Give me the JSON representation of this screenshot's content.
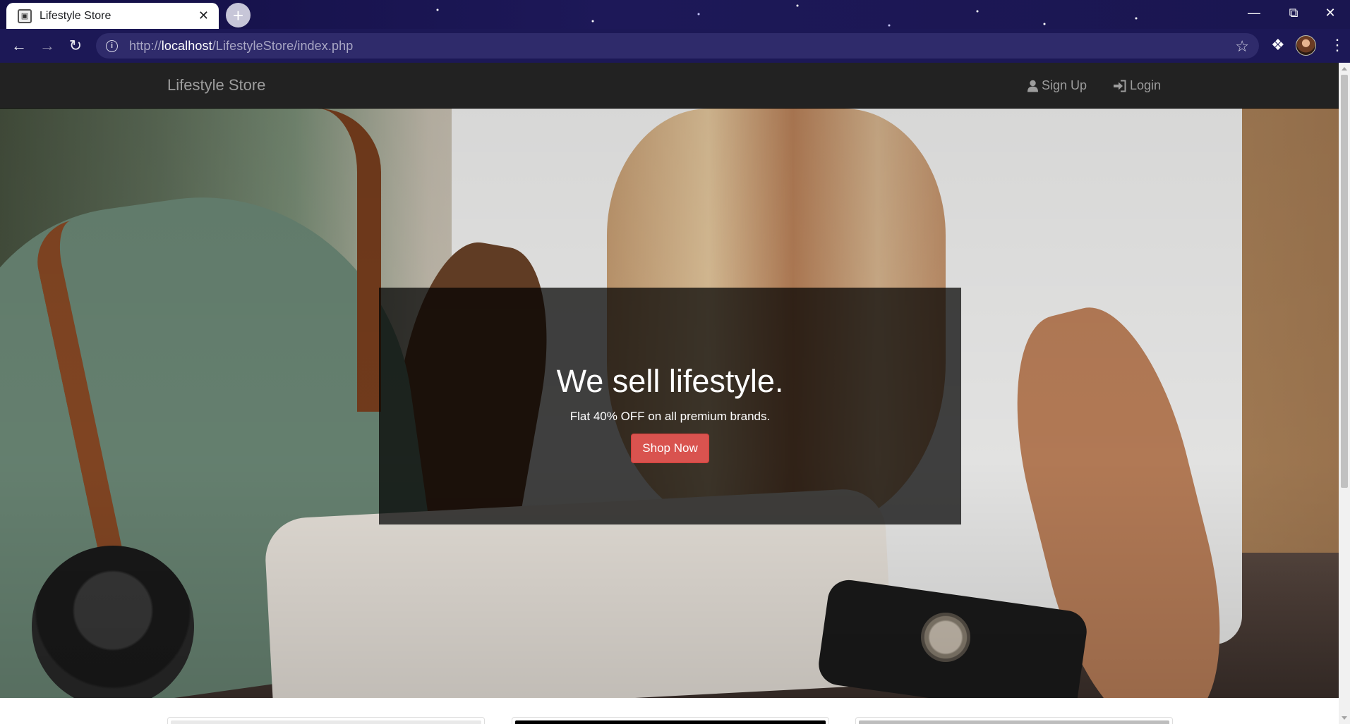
{
  "browser": {
    "tab_title": "Lifestyle Store",
    "new_tab_symbol": "+",
    "url_scheme": "http://",
    "url_host": "localhost",
    "url_path": "/LifestyleStore/index.php",
    "icons": [
      "back-icon",
      "forward-icon",
      "reload-icon",
      "info-icon",
      "star-icon",
      "extensions-icon",
      "avatar",
      "menu-icon",
      "minimize-icon",
      "restore-icon",
      "close-icon"
    ]
  },
  "site": {
    "brand": "Lifestyle Store",
    "nav": {
      "signup_label": "Sign Up",
      "login_label": "Login"
    }
  },
  "hero": {
    "title": "We sell lifestyle.",
    "subtitle": "Flat 40% OFF on all premium brands.",
    "cta_label": "Shop Now"
  },
  "colors": {
    "navbar": "#222222",
    "nav_text": "#9d9d9d",
    "cta": "#d9534f",
    "banner_overlay": "rgba(0,0,0,0.72)"
  }
}
